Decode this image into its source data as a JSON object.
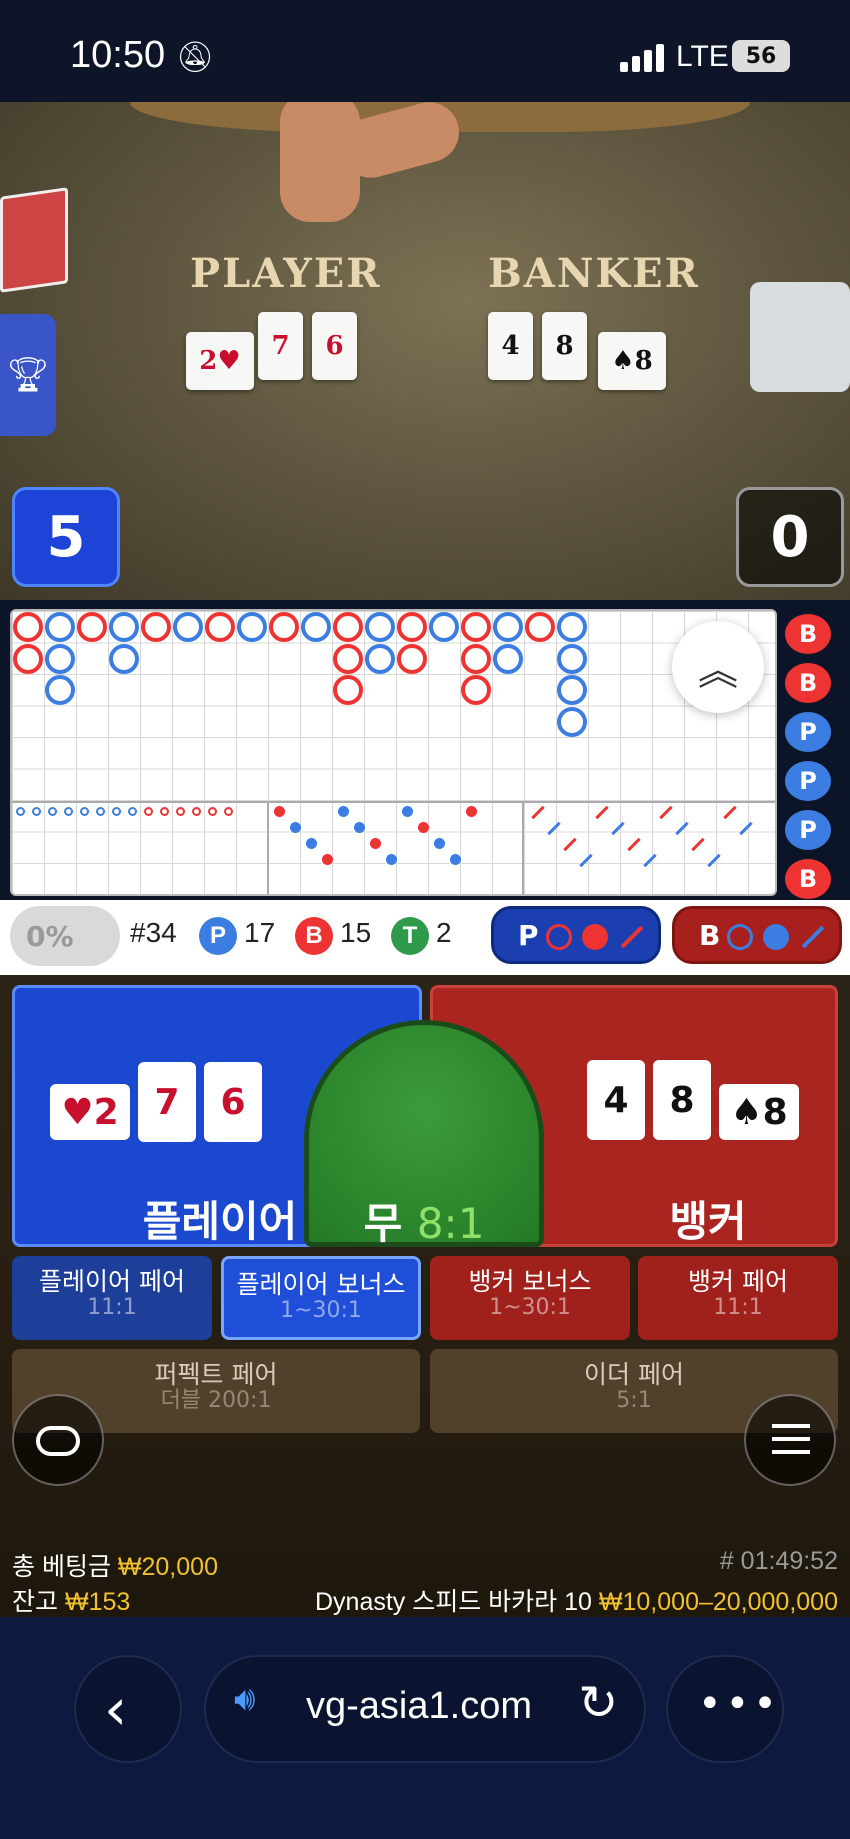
{
  "status": {
    "time": "10:50",
    "network": "LTE",
    "battery": "56"
  },
  "table": {
    "player_label": "PLAYER",
    "banker_label": "BANKER",
    "player_score": "5",
    "banker_score": "0",
    "player_cards": [
      "2",
      "7",
      "6"
    ],
    "banker_cards": [
      "4",
      "8",
      "8"
    ]
  },
  "stats": {
    "percent": "0%",
    "round": "#34",
    "p_letter": "P",
    "p_count": "17",
    "b_letter": "B",
    "b_count": "15",
    "t_letter": "T",
    "t_count": "2",
    "p_predict": "P",
    "b_predict": "B"
  },
  "sidebar_results": [
    "B",
    "B",
    "P",
    "P",
    "P",
    "B"
  ],
  "bets": {
    "player": "플레이어",
    "tie": "무",
    "tie_odds": "8:1",
    "banker": "뱅커",
    "player_pair": "플레이어 페어",
    "player_pair_odds": "11:1",
    "player_bonus": "플레이어 보너스",
    "player_bonus_odds": "1~30:1",
    "banker_bonus": "뱅커 보너스",
    "banker_bonus_odds": "1~30:1",
    "banker_pair": "뱅커 페어",
    "banker_pair_odds": "11:1",
    "perfect_pair": "퍼펙트 페어",
    "perfect_pair_odds": "더블 200:1",
    "either_pair": "이더 페어",
    "either_pair_odds": "5:1"
  },
  "footer": {
    "total_bet_label": "총 베팅금",
    "total_bet": "₩20,000",
    "balance_label": "잔고",
    "balance": "₩153",
    "game_id": "# 01:49:52",
    "table_name": "Dynasty 스피드 바카라 10",
    "limits": "₩10,000–20,000,000"
  },
  "browser": {
    "url": "vg-asia1.com"
  },
  "colors": {
    "player": "#1f4fd8",
    "banker": "#b3241f",
    "tie": "#2e8b2e",
    "gold": "#f2c12e"
  }
}
